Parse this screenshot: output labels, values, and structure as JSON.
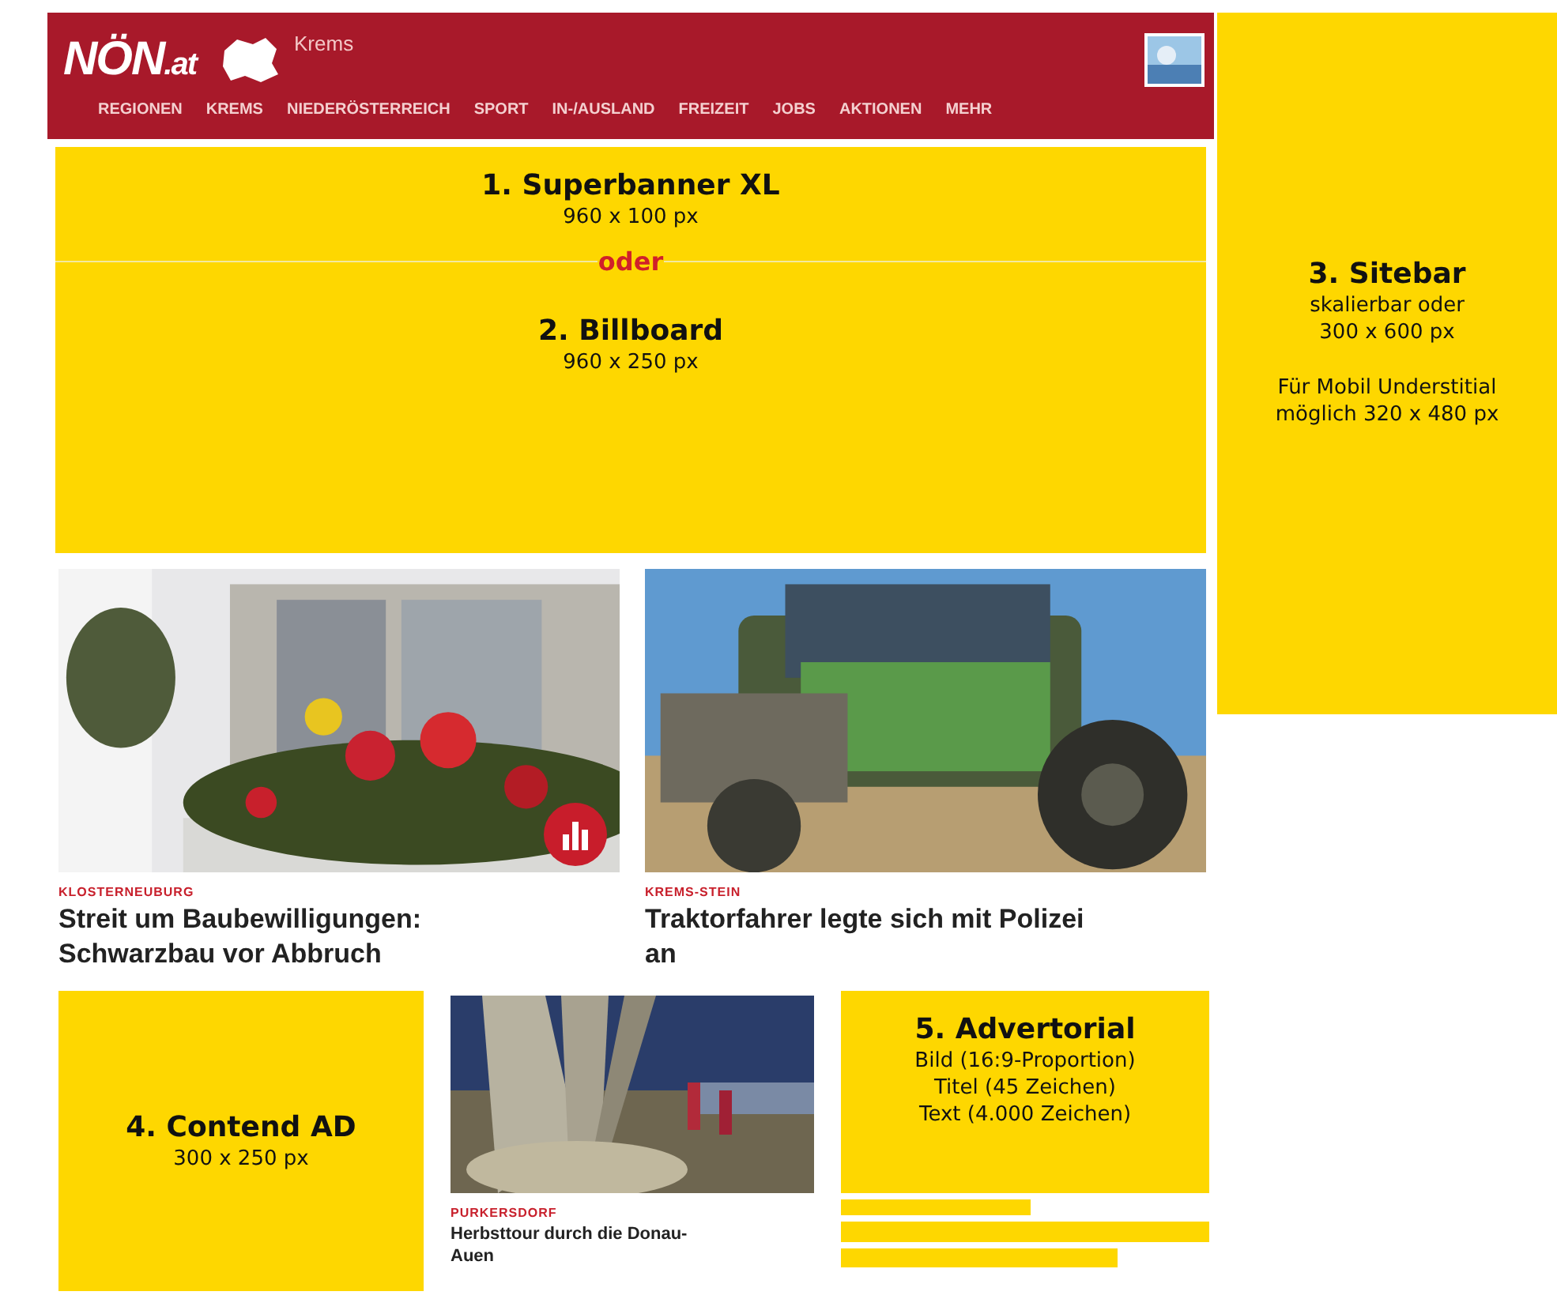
{
  "header": {
    "logo": "NÖN",
    "logo_suffix": ".at",
    "region": "Krems",
    "nav": [
      {
        "label": "REGIONEN"
      },
      {
        "label": "KREMS"
      },
      {
        "label": "NIEDERÖSTERREICH"
      },
      {
        "label": "SPORT"
      },
      {
        "label": "IN-/AUSLAND"
      },
      {
        "label": "FREIZEIT"
      },
      {
        "label": "JOBS"
      },
      {
        "label": "AKTIONEN"
      },
      {
        "label": "MEHR"
      }
    ]
  },
  "superbanner": {
    "title": "1. Superbanner XL",
    "lines": [
      "960 x 100 px"
    ]
  },
  "separator": "oder",
  "billboard": {
    "title": "2. Billboard",
    "lines": [
      "960 x 250 px"
    ]
  },
  "sitebar": {
    "title": "3. Sitebar",
    "lines": [
      "skalierbar oder",
      "300 x 600 px"
    ],
    "note": "Für Mobil Understitial möglich 320 x 480 px"
  },
  "articles": [
    {
      "category": "KLOSTERNEUBURG",
      "headline": "Streit um Baubewilligungen: Schwarzbau vor Abbruch",
      "kind": "flowers",
      "badge": true
    },
    {
      "category": "KREMS-STEIN",
      "headline": "Traktorfahrer legte sich mit Polizei an",
      "kind": "tractor",
      "badge": false
    }
  ],
  "content_ad": {
    "title": "4. Contend AD",
    "lines": [
      "300 x 250 px"
    ]
  },
  "small_article": {
    "category": "PURKERSDORF",
    "headline": "Herbsttour durch die Donau-Auen",
    "kind": "trees"
  },
  "advertorial": {
    "title": "5. Advertorial",
    "lines": [
      "Bild (16:9-Proportion)",
      "Titel (45 Zeichen)",
      "Text (4.000 Zeichen)"
    ]
  }
}
